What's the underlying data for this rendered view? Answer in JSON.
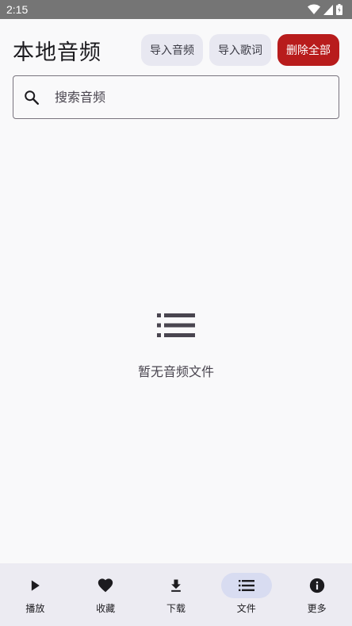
{
  "status_bar": {
    "time": "2:15",
    "icons": [
      "wifi-icon",
      "signal-icon",
      "battery-icon"
    ]
  },
  "header": {
    "title": "本地音频",
    "import_audio_label": "导入音频",
    "import_lyrics_label": "导入歌词",
    "delete_all_label": "删除全部"
  },
  "search": {
    "placeholder": "搜索音频",
    "value": ""
  },
  "empty_state": {
    "icon": "list-icon",
    "text": "暂无音频文件"
  },
  "nav": {
    "items": [
      {
        "label": "播放",
        "icon": "play-icon",
        "active": false
      },
      {
        "label": "收藏",
        "icon": "heart-icon",
        "active": false
      },
      {
        "label": "下载",
        "icon": "download-icon",
        "active": false
      },
      {
        "label": "文件",
        "icon": "list-icon",
        "active": true
      },
      {
        "label": "更多",
        "icon": "info-icon",
        "active": false
      }
    ]
  },
  "colors": {
    "accent_danger": "#b81c1c",
    "tonal_button": "#e8e8f1",
    "nav_background": "#ecebf2",
    "nav_active_pill": "#d8dcf1",
    "status_bar": "#757575"
  }
}
